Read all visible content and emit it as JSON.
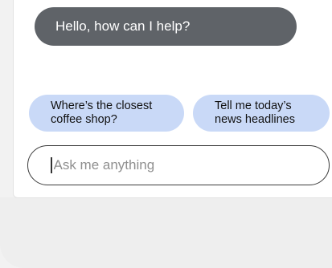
{
  "assistant": {
    "greeting": "Hello, how can I help?"
  },
  "suggestions": [
    {
      "label": "Where’s the closest\ncoffee shop?"
    },
    {
      "label": "Tell me today’s\nnews headlines"
    }
  ],
  "composer": {
    "placeholder": "Ask me anything",
    "value": ""
  },
  "colors": {
    "assistant_bubble": "#5f6368",
    "suggestion_chip": "#c9d9f7",
    "input_border": "#3c3c3c"
  }
}
